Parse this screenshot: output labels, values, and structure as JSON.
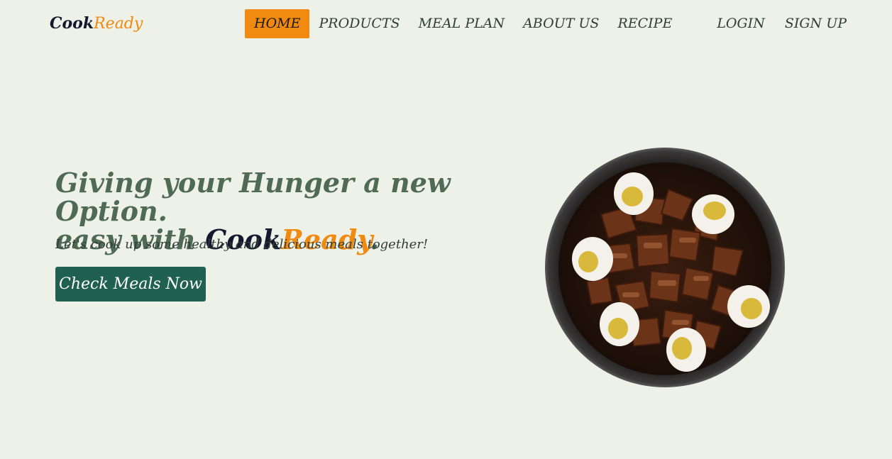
{
  "logo": {
    "cook": "Cook",
    "ready": "Ready"
  },
  "nav": {
    "items": [
      {
        "label": "HOME",
        "active": true
      },
      {
        "label": "PRODUCTS"
      },
      {
        "label": "MEAL PLAN"
      },
      {
        "label": "ABOUT US"
      },
      {
        "label": "RECIPE"
      }
    ]
  },
  "auth": {
    "login": "LOGIN",
    "signup": "SIGN UP"
  },
  "hero": {
    "line1": "Giving your Hunger a new Option.",
    "line2_prefix": "easy with ",
    "brand_cook": "Cook",
    "brand_ready": "Ready",
    "line2_suffix": ".",
    "subtitle": "Let's cook up some healthy and delicious meals together!",
    "cta_label": "Check Meals Now"
  },
  "colors": {
    "background": "#eef1e7",
    "accent": "#f08a11",
    "primary": "#1f6050",
    "headline": "#4f6b55"
  },
  "icons": {
    "hero_image": "pork-adobo-with-eggs-dish"
  }
}
